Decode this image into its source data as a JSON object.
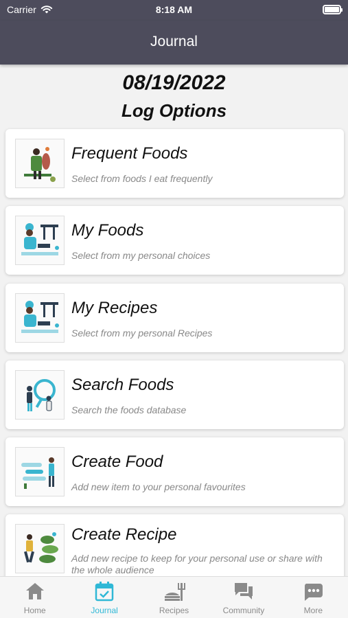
{
  "status_bar": {
    "carrier": "Carrier",
    "time": "8:18 AM"
  },
  "nav": {
    "title": "Journal"
  },
  "date": "08/19/2022",
  "subtitle": "Log Options",
  "options": [
    {
      "title": "Frequent Foods",
      "desc": "Select from foods I eat frequently",
      "icon": "frequent-foods-illustration"
    },
    {
      "title": "My Foods",
      "desc": "Select from my personal choices",
      "icon": "chef-cooking-illustration"
    },
    {
      "title": "My Recipes",
      "desc": "Select from my personal Recipes",
      "icon": "chef-cooking-illustration"
    },
    {
      "title": "Search Foods",
      "desc": "Search the foods database",
      "icon": "magnifier-people-illustration"
    },
    {
      "title": "Create Food",
      "desc": "Add new item to your personal favourites",
      "icon": "create-food-illustration"
    },
    {
      "title": "Create Recipe",
      "desc": "Add new recipe to keep for your personal use or share with the whole audience",
      "icon": "create-recipe-illustration"
    }
  ],
  "tabs": [
    {
      "label": "Home",
      "icon": "home-icon",
      "active": false
    },
    {
      "label": "Journal",
      "icon": "calendar-icon",
      "active": true
    },
    {
      "label": "Recipes",
      "icon": "recipes-icon",
      "active": false
    },
    {
      "label": "Community",
      "icon": "chat-icon",
      "active": false
    },
    {
      "label": "More",
      "icon": "more-icon",
      "active": false
    }
  ],
  "colors": {
    "header": "#4d4c5c",
    "accent": "#2fb8d6",
    "tab_inactive": "#8a8a8a"
  }
}
